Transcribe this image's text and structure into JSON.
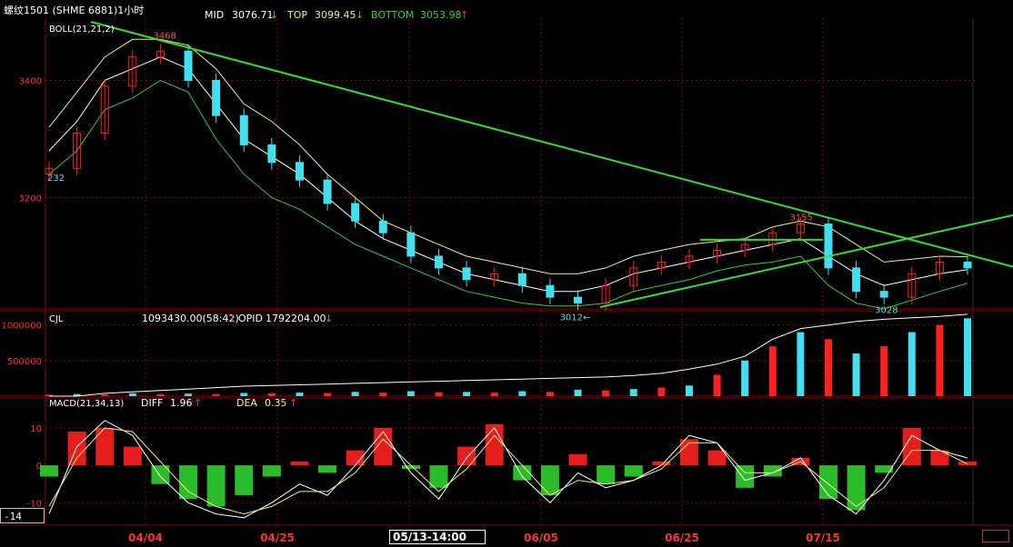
{
  "header": {
    "symbol": "螺纹1501 (SHME 6881)1小时",
    "mid_label": "MID",
    "mid_value": "3076.71",
    "mid_arrow": "↓",
    "top_label": "TOP",
    "top_value": "3099.45",
    "top_arrow": "↓",
    "bottom_label": "BOTTOM",
    "bottom_value": "3053.98",
    "bottom_arrow": "↑"
  },
  "boll_panel": {
    "indicator_label": "BOLL(21,21,2)",
    "y_ticks": [
      "3400",
      "3200"
    ],
    "annotations": [
      "3468",
      "232",
      "3012",
      "3155",
      "3028"
    ]
  },
  "volume_panel": {
    "label": "CJL",
    "volume_value": "1093430.00(58:42)",
    "volume_arrow": "↑",
    "opid_label": "OPID",
    "opid_value": "1792204.00",
    "opid_arrow": "↓",
    "y_ticks": [
      "1000000",
      "500000"
    ]
  },
  "macd_panel": {
    "label": "MACD(21,34,13)",
    "diff_label": "DIFF",
    "diff_value": "1.96",
    "diff_arrow": "↑",
    "dea_label": "DEA",
    "dea_value": "0.35",
    "dea_arrow": "↑",
    "y_ticks": [
      "10",
      "0",
      "-10"
    ]
  },
  "x_axis": {
    "dates": [
      "04/04",
      "04/25",
      "06/05",
      "06/25",
      "07/15"
    ]
  },
  "cursor_value": "-14",
  "cursor_date": "05/13-14:00",
  "colors": {
    "background": "#000000",
    "grid": "#8b0000",
    "up_candle": "#ff2020",
    "down_candle": "#40e0f0",
    "boll_mid": "#ffffff",
    "boll_top": "#f0f080",
    "boll_bottom": "#30d030",
    "trendline": "#30e030",
    "axis_text": "#ff3030"
  },
  "chart_data": [
    {
      "type": "candlestick",
      "title": "BOLL(21,21,2)",
      "ylim": [
        3010,
        3500
      ],
      "series": [
        {
          "name": "MID",
          "values": [
            3280,
            3330,
            3400,
            3420,
            3440,
            3420,
            3360,
            3300,
            3270,
            3240,
            3200,
            3160,
            3130,
            3110,
            3090,
            3070,
            3060,
            3050,
            3040,
            3040,
            3050,
            3070,
            3080,
            3090,
            3100,
            3110,
            3120,
            3130,
            3100,
            3070,
            3050,
            3060,
            3070,
            3077
          ]
        },
        {
          "name": "TOP",
          "values": [
            3320,
            3380,
            3440,
            3470,
            3470,
            3460,
            3420,
            3360,
            3330,
            3290,
            3240,
            3200,
            3160,
            3140,
            3120,
            3100,
            3090,
            3080,
            3070,
            3070,
            3080,
            3100,
            3110,
            3120,
            3125,
            3130,
            3150,
            3160,
            3150,
            3120,
            3090,
            3095,
            3100,
            3099
          ]
        },
        {
          "name": "BOTTOM",
          "values": [
            3240,
            3280,
            3350,
            3370,
            3400,
            3380,
            3300,
            3240,
            3200,
            3180,
            3150,
            3120,
            3100,
            3080,
            3060,
            3040,
            3030,
            3020,
            3015,
            3015,
            3020,
            3040,
            3050,
            3060,
            3075,
            3085,
            3090,
            3100,
            3050,
            3020,
            3010,
            3025,
            3040,
            3054
          ]
        }
      ],
      "closes": [
        3250,
        3310,
        3390,
        3440,
        3450,
        3400,
        3340,
        3290,
        3260,
        3230,
        3190,
        3160,
        3140,
        3100,
        3080,
        3060,
        3070,
        3050,
        3030,
        3020,
        3050,
        3080,
        3090,
        3100,
        3110,
        3120,
        3140,
        3155,
        3080,
        3040,
        3030,
        3070,
        3090,
        3080
      ],
      "high_label": 3468,
      "low_labels": [
        3012,
        3028
      ],
      "other_label": 3155
    },
    {
      "type": "bar",
      "title": "CJL",
      "ylim": [
        0,
        1200000
      ],
      "series": [
        {
          "name": "OPID",
          "values": [
            0,
            0,
            40000,
            60000,
            80000,
            100000,
            120000,
            140000,
            150000,
            160000,
            170000,
            180000,
            190000,
            200000,
            210000,
            220000,
            230000,
            240000,
            250000,
            260000,
            270000,
            290000,
            320000,
            380000,
            450000,
            560000,
            800000,
            950000,
            1000000,
            1050000,
            1080000,
            1100000,
            1120000,
            1150000
          ]
        }
      ],
      "volume": [
        20000,
        30000,
        25000,
        40000,
        30000,
        35000,
        30000,
        45000,
        40000,
        50000,
        45000,
        60000,
        50000,
        70000,
        55000,
        60000,
        50000,
        70000,
        60000,
        90000,
        80000,
        100000,
        120000,
        150000,
        300000,
        500000,
        700000,
        900000,
        800000,
        600000,
        700000,
        900000,
        1000000,
        1093430
      ]
    },
    {
      "type": "bar",
      "title": "MACD(21,34,13)",
      "ylim": [
        -16,
        18
      ],
      "histogram": [
        -3,
        9,
        10,
        5,
        -5,
        -9,
        -11,
        -8,
        -3,
        1,
        -2,
        4,
        10,
        -1,
        -6,
        5,
        11,
        -4,
        -8,
        3,
        -5,
        -3,
        1,
        7,
        4,
        -6,
        -3,
        2,
        -9,
        -12,
        -2,
        10,
        4,
        1
      ],
      "series": [
        {
          "name": "DIFF",
          "values": [
            -13,
            5,
            12,
            8,
            -3,
            -10,
            -13,
            -14,
            -10,
            -5,
            -8,
            0,
            9,
            -2,
            -9,
            2,
            10,
            -3,
            -10,
            -2,
            -6,
            -4,
            0,
            8,
            6,
            -4,
            -2,
            2,
            -8,
            -13,
            -4,
            8,
            4,
            1.96
          ]
        },
        {
          "name": "DEA",
          "values": [
            -11,
            2,
            10,
            9,
            1,
            -7,
            -11,
            -13,
            -11,
            -7,
            -7,
            -2,
            7,
            0,
            -7,
            -1,
            8,
            0,
            -8,
            -4,
            -5,
            -4,
            -1,
            6,
            6,
            -2,
            -2,
            1,
            -5,
            -11,
            -6,
            4,
            4,
            0.35
          ]
        }
      ]
    }
  ]
}
